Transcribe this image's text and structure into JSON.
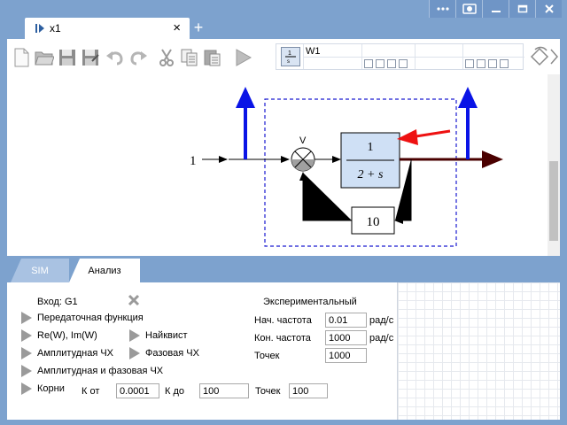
{
  "window": {
    "tab_title": "x1",
    "close_glyph": "×",
    "new_tab_glyph": "+"
  },
  "toolbar": {
    "block_label": "W1"
  },
  "diagram": {
    "input_value": "1",
    "numerator": "1",
    "denominator": "2 + s",
    "feedback_gain": "10",
    "sum_sign": "V"
  },
  "panel": {
    "tabs": [
      {
        "label": "SIM"
      },
      {
        "label": "Анализ"
      }
    ],
    "input_label": "Вход: G1",
    "experimental_label": "Экспериментальный",
    "buttons": {
      "transfer_function": "Передаточная функция",
      "re_im": "Re(W), Im(W)",
      "nyquist": "Найквист",
      "amplitude": "Амплитудная ЧХ",
      "phase": "Фазовая ЧХ",
      "amp_phase": "Амплитудная и фазовая ЧХ",
      "roots": "Корни"
    },
    "fields": {
      "start_freq_label": "Нач. частота",
      "start_freq_value": "0.01",
      "start_freq_unit": "рад/с",
      "end_freq_label": "Кон. частота",
      "end_freq_value": "1000",
      "end_freq_unit": "рад/с",
      "points_label": "Точек",
      "points_value": "1000",
      "k_from_label": "К от",
      "k_from_value": "0.0001",
      "k_to_label": "К до",
      "k_to_value": "100",
      "roots_points_label": "Точек",
      "roots_points_value": "100"
    }
  },
  "colors": {
    "chrome": "#7da2ce",
    "blue_arrow": "#0a14e6",
    "red_arrow": "#ee1111",
    "output_arrow": "#4a0000",
    "block_fill": "#cfe0f5",
    "dashed": "#1a1ad0"
  },
  "icons": [
    "restart-icon",
    "capture-icon",
    "minimize-icon",
    "maximize-icon",
    "close-icon",
    "new-file-icon",
    "open-folder-icon",
    "save-icon",
    "save-as-icon",
    "undo-icon",
    "redo-icon",
    "cut-icon",
    "copy-icon",
    "paste-icon",
    "run-icon",
    "transfer-function-icon",
    "rotate-icon"
  ]
}
